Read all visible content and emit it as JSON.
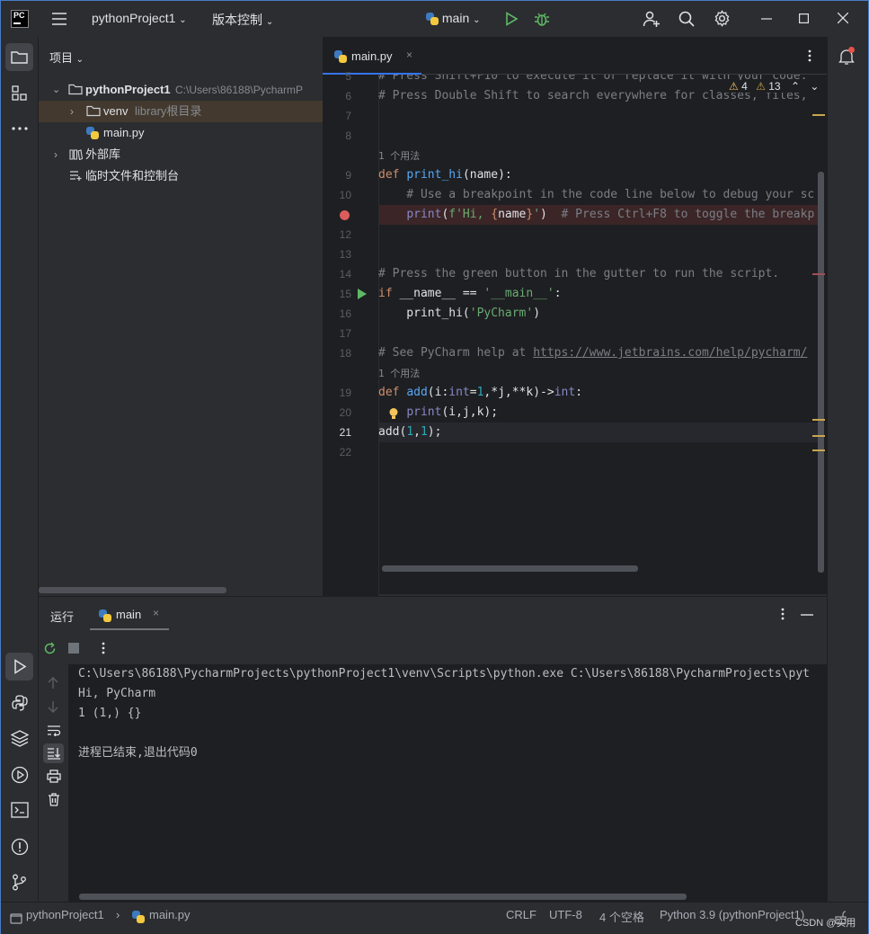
{
  "titlebar": {
    "project_name": "pythonProject1",
    "vcs_label": "版本控制",
    "run_config": "main"
  },
  "project_panel": {
    "header": "项目",
    "root_name": "pythonProject1",
    "root_path": "C:\\Users\\86188\\PycharmP",
    "venv_name": "venv",
    "venv_hint": "library根目录",
    "main_file": "main.py",
    "external_libs": "外部库",
    "scratches": "临时文件和控制台"
  },
  "editor": {
    "tab_label": "main.py",
    "warnings_count": "4",
    "weak_warnings_count": "13",
    "usages_hint_1": "1 个用法",
    "usages_hint_2": "1 个用法",
    "line_numbers": [
      "5",
      "6",
      "7",
      "8",
      "9",
      "10",
      "12",
      "13",
      "14",
      "15",
      "16",
      "17",
      "18",
      "19",
      "20",
      "21",
      "22"
    ],
    "lines": {
      "l5": "# Press Shift+F10 to execute it or replace it with your code.",
      "l6": "# Press Double Shift to search everywhere for classes, files,",
      "l10": "    # Use a breakpoint in the code line below to debug your sc",
      "l11_comment": "  # Press Ctrl+F8 to toggle the breakp",
      "l14": "# Press the green button in the gutter to run the script.",
      "l18_comment": "# See PyCharm help at ",
      "l18_url": "https://www.jetbrains.com/help/pycharm/"
    }
  },
  "run_panel": {
    "tab_run": "运行",
    "tab_main": "main",
    "console_lines": [
      "C:\\Users\\86188\\PycharmProjects\\pythonProject1\\venv\\Scripts\\python.exe C:\\Users\\86188\\PycharmProjects\\pyt",
      "Hi, PyCharm",
      "1 (1,) {}",
      "",
      "进程已结束,退出代码0"
    ]
  },
  "statusbar": {
    "crumb_project": "pythonProject1",
    "crumb_file": "main.py",
    "line_sep": "CRLF",
    "encoding": "UTF-8",
    "indent": "4 个空格",
    "interpreter": "Python 3.9 (pythonProject1)",
    "watermark": "CSDN @实用"
  },
  "colors": {
    "accent": "#3574f0",
    "breakpoint": "#db5c5c",
    "run_green": "#5fb865",
    "breakpoint_line_bg": "#3b2527"
  }
}
